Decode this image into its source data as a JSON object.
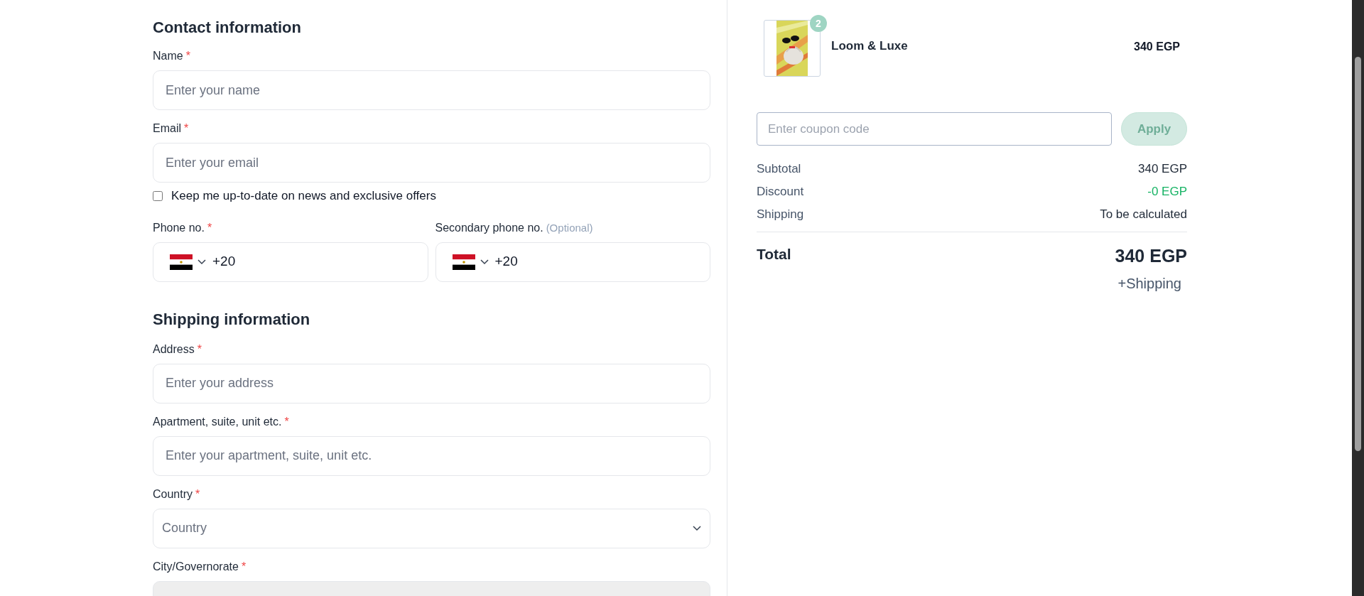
{
  "contact": {
    "title": "Contact information",
    "name": {
      "label": "Name",
      "mark": "*",
      "placeholder": "Enter your name"
    },
    "email": {
      "label": "Email",
      "mark": "*",
      "placeholder": "Enter your email"
    },
    "newsletter": {
      "label": "Keep me up-to-date on news and exclusive offers",
      "checked": false
    },
    "phones": [
      {
        "label": "Phone no.",
        "mark": "*",
        "code": "+20"
      },
      {
        "label": "Secondary phone no.",
        "note": "(Optional)",
        "code": "+20"
      }
    ]
  },
  "shipping": {
    "title": "Shipping information",
    "fields": [
      {
        "kind": "text",
        "label": "Address",
        "mark": "*",
        "placeholder": "Enter your address",
        "disabled": false
      },
      {
        "kind": "text",
        "label": "Apartment, suite, unit etc.",
        "mark": "*",
        "placeholder": "Enter your apartment, suite, unit etc.",
        "disabled": false
      },
      {
        "kind": "select",
        "label": "Country",
        "mark": "*",
        "placeholder": "Country",
        "disabled": false
      },
      {
        "kind": "select",
        "label": "City/Governorate",
        "mark": "*",
        "disabled": true
      }
    ]
  },
  "summary": {
    "item": {
      "quantity": "2",
      "name": "Loom & Luxe",
      "price": "340 EGP"
    },
    "coupon": {
      "placeholder": "Enter coupon code",
      "button": "Apply",
      "disabled": true
    },
    "lines": [
      {
        "label": "Subtotal",
        "value": "340 EGP",
        "kind": "plain"
      },
      {
        "label": "Discount",
        "value": "-0 EGP",
        "kind": "discount"
      },
      {
        "label": "Shipping",
        "value": "To be calculated",
        "kind": "plain"
      }
    ],
    "total": {
      "label": "Total",
      "value": "340 EGP",
      "note": "+Shipping"
    }
  }
}
